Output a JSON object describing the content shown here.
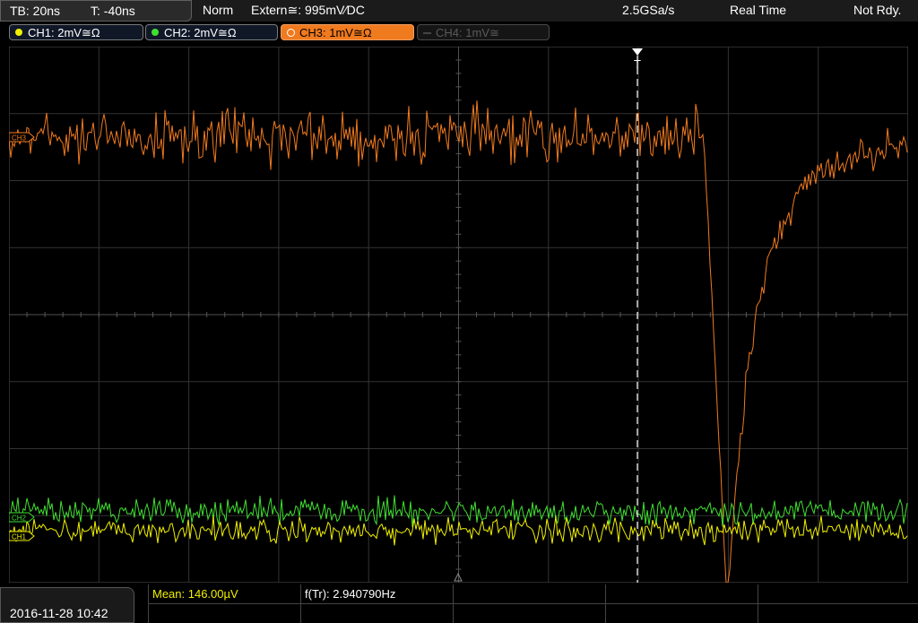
{
  "top_bar": {
    "timebase": "TB: 20ns",
    "trigger_time": "T: -40ns",
    "mode": "Norm",
    "trigger_source": "Extern≅: 995mV∕DC",
    "sample_rate": "2.5GSa/s",
    "acquisition": "Real Time",
    "status": "Not Rdy."
  },
  "channels": [
    {
      "label": "CH1: 2mV≅Ω",
      "color": "#f0f000",
      "state": "on"
    },
    {
      "label": "CH2: 2mV≅Ω",
      "color": "#40e030",
      "state": "on"
    },
    {
      "label": "CH3: 1mV≅Ω",
      "color": "#f07a1e",
      "state": "active"
    },
    {
      "label": "CH4: 1mV≅",
      "color": "#5a5a5a",
      "state": "off"
    }
  ],
  "screen": {
    "trigger_marker": "T",
    "ch3_marker": "CH3",
    "ch2_marker": "CH2",
    "ch1_marker": "CH1"
  },
  "bottom_bar": {
    "datetime": "2016-11-28 10:42",
    "measurements": [
      {
        "label": "Mean: 146.00µV",
        "color": "#f0f000"
      },
      {
        "label": "f(Tr): 2.940790Hz",
        "color": "#ffffff"
      }
    ]
  },
  "colors": {
    "ch1": "#f0f000",
    "ch2": "#40e030",
    "ch3": "#f07a1e",
    "grid": "#3a3a3a"
  }
}
